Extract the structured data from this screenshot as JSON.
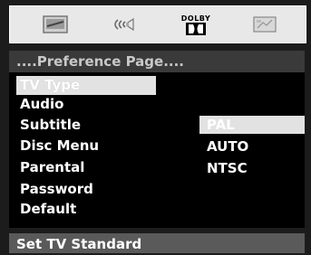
{
  "icon_bar": {
    "icons": [
      "general-setup-icon",
      "audio-setup-icon",
      "dolby-icon",
      "preference-icon"
    ],
    "dolby_text": "DOLBY"
  },
  "title": "....Preference Page....",
  "menu": {
    "items": [
      {
        "label": "TV Type",
        "selected": true
      },
      {
        "label": "Audio"
      },
      {
        "label": "Subtitle"
      },
      {
        "label": "Disc Menu"
      },
      {
        "label": "Parental"
      },
      {
        "label": "Password"
      },
      {
        "label": "Default"
      }
    ]
  },
  "options": {
    "items": [
      {
        "label": "PAL",
        "selected": true
      },
      {
        "label": "AUTO"
      },
      {
        "label": "NTSC"
      }
    ]
  },
  "status": "Set TV Standard",
  "colors": {
    "background": "#1c1c1c",
    "highlight": "#e2e2e2",
    "title_bar": "#3a3a3a",
    "status_bar": "#5a5a5a",
    "text": "#ffffff"
  }
}
